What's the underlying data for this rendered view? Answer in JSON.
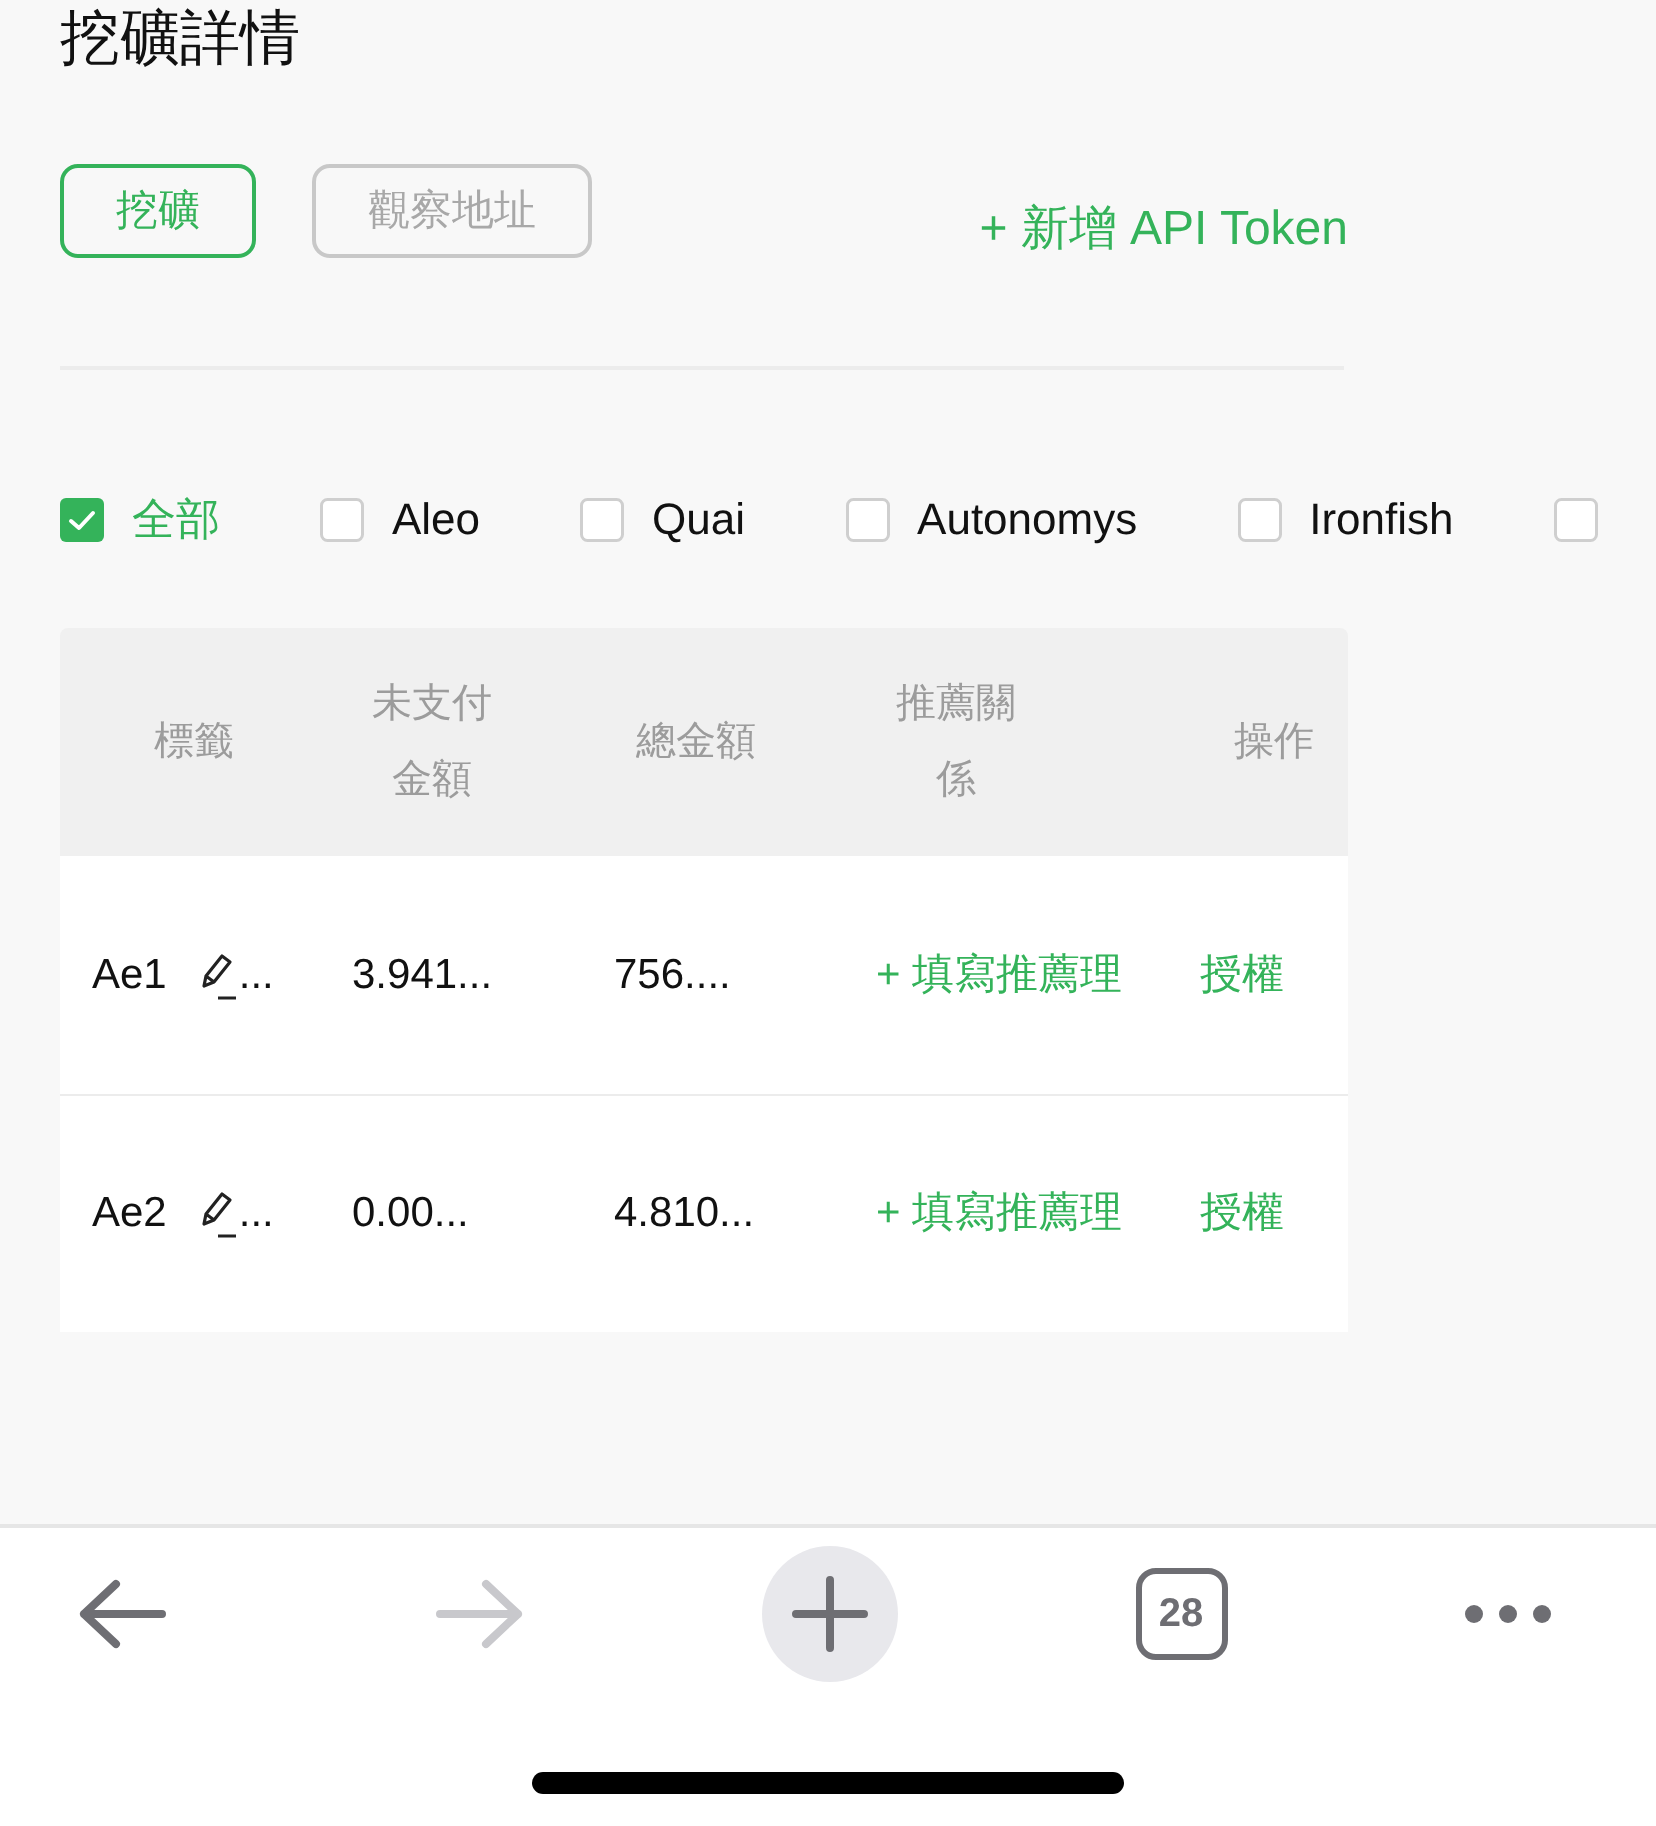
{
  "page": {
    "title": "挖礦詳情"
  },
  "tabs": [
    {
      "label": "挖礦",
      "selected": true
    },
    {
      "label": "觀察地址",
      "selected": false
    }
  ],
  "add_token_link": {
    "label": "+ 新增 API Token"
  },
  "filters": [
    {
      "label": "全部",
      "checked": true
    },
    {
      "label": "Aleo",
      "checked": false
    },
    {
      "label": "Quai",
      "checked": false
    },
    {
      "label": "Autonomys",
      "checked": false
    },
    {
      "label": "Ironfish",
      "checked": false
    },
    {
      "checked": false
    }
  ],
  "table": {
    "columns": [
      "標籤",
      "未支付金額",
      "總金額",
      "推薦關係",
      "操作"
    ],
    "rows": [
      {
        "label": "Ae1",
        "label_overflow": "...",
        "unpaid": "3.941...",
        "total": "756....",
        "referral_link": "+ 填寫推薦理",
        "action_link": "授權"
      },
      {
        "label": "Ae2",
        "label_overflow": "...",
        "unpaid": "0.00...",
        "total": "4.810...",
        "referral_link": "+ 填寫推薦理",
        "action_link": "授權"
      }
    ]
  },
  "browser_toolbar": {
    "back": {
      "disabled": false
    },
    "forward": {
      "disabled": true
    },
    "tab_count": "28"
  }
}
